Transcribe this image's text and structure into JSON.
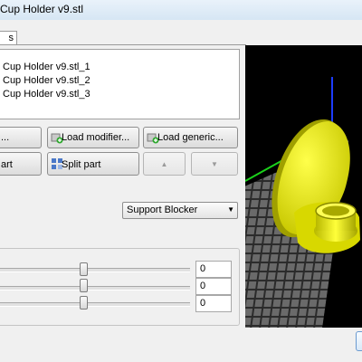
{
  "window": {
    "title": "Cup Holder v9.stl"
  },
  "tabs": [
    {
      "label": "s"
    }
  ],
  "object_list": [
    {
      "name": "Cup Holder v9.stl_1"
    },
    {
      "name": "Cup Holder v9.stl_2"
    },
    {
      "name": "Cup Holder v9.stl_3"
    }
  ],
  "buttons": {
    "load_part": "...",
    "load_modifier": "Load modifier...",
    "load_generic": "Load generic...",
    "delete_part": "art",
    "split_part": "Split part",
    "move_up_glyph": "▲",
    "move_down_glyph": "▼"
  },
  "settings": {
    "selected_type": "Support Blocker"
  },
  "sliders": [
    {
      "value": 0
    },
    {
      "value": 0
    },
    {
      "value": 0
    }
  ],
  "slider_values": [
    "0",
    "0",
    "0"
  ],
  "colors": {
    "model": "#e8e800",
    "bed_grid": "#5a5a5a",
    "background": "#000000",
    "axis_z": "#1c3cff",
    "axis_y": "#1bd11b"
  }
}
